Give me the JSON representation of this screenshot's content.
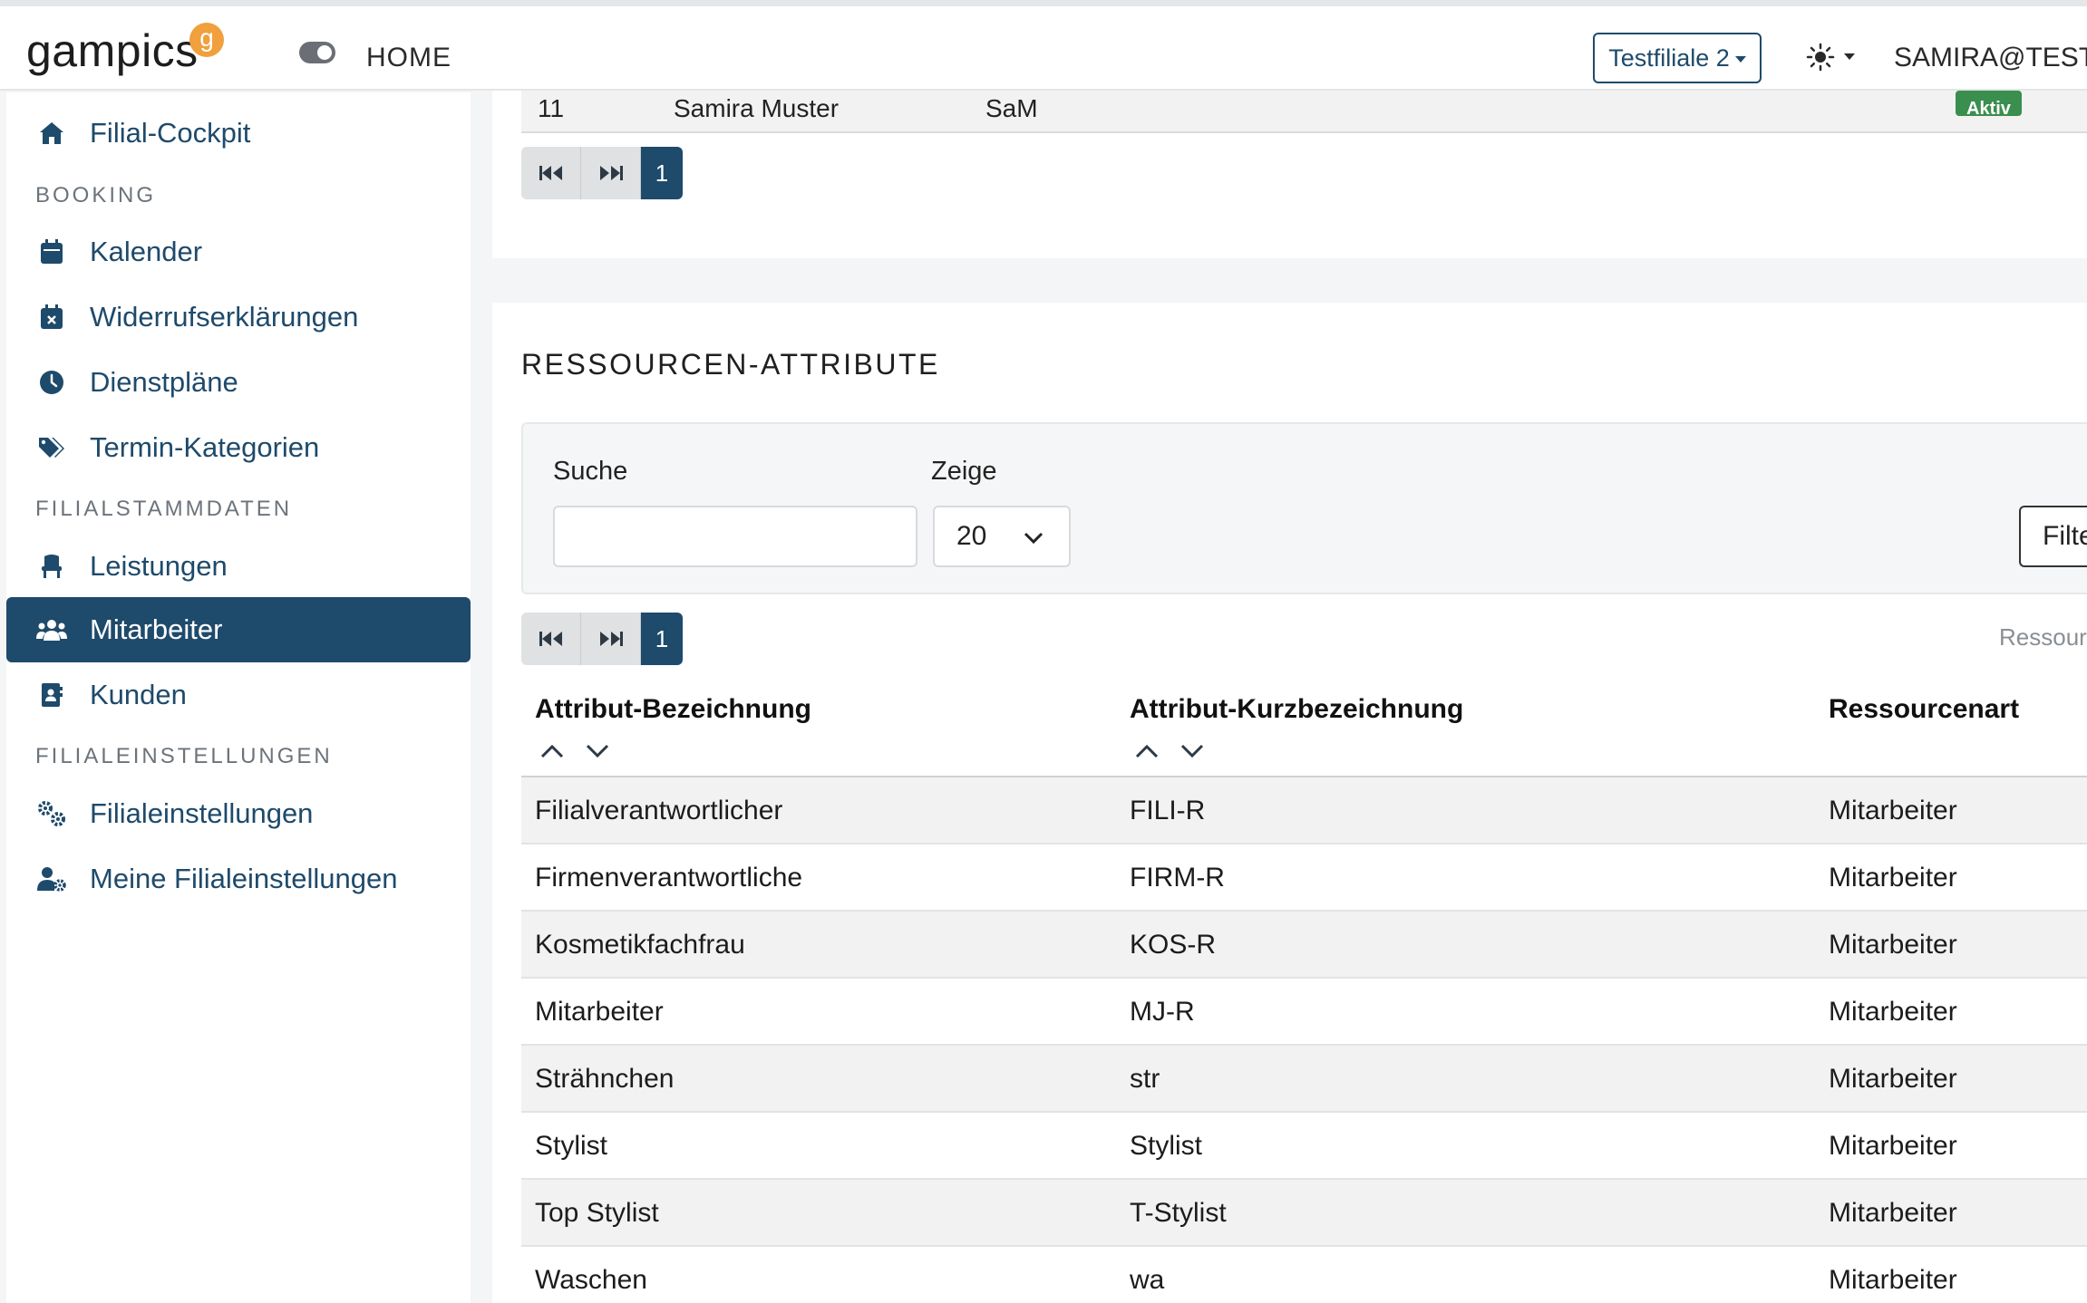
{
  "header": {
    "logo_text": "gampics",
    "logo_badge": "g",
    "home_label": "HOME",
    "branch_label": "Testfiliale 2",
    "user_label": "SAMIRA@TEST.G"
  },
  "sidebar": {
    "items": [
      {
        "label": "Filial-Cockpit",
        "icon": "home-icon"
      },
      {
        "label": "Kalender",
        "icon": "calendar-icon"
      },
      {
        "label": "Widerrufserklärungen",
        "icon": "calendar-x-icon"
      },
      {
        "label": "Dienstpläne",
        "icon": "clock-icon"
      },
      {
        "label": "Termin-Kategorien",
        "icon": "tags-icon"
      },
      {
        "label": "Leistungen",
        "icon": "chair-icon"
      },
      {
        "label": "Mitarbeiter",
        "icon": "users-icon",
        "active": true
      },
      {
        "label": "Kunden",
        "icon": "contact-book-icon"
      },
      {
        "label": "Filialeinstellungen",
        "icon": "gears-icon"
      },
      {
        "label": "Meine Filialeinstellungen",
        "icon": "user-gear-icon"
      }
    ],
    "sections": [
      "BOOKING",
      "FILIALSTAMMDATEN",
      "FILIALEINSTELLUNGEN"
    ]
  },
  "prev_table": {
    "row": {
      "col1": "11",
      "col2": "Samira Muster",
      "col3": "SaM",
      "status": "Aktiv"
    },
    "page": "1"
  },
  "attributes": {
    "title": "RESSOURCEN-ATTRIBUTE",
    "search_label": "Suche",
    "search_value": "",
    "show_label": "Zeige",
    "show_value": "20",
    "filter_label": "Filter",
    "page": "1",
    "resource_label_partial": "Ressour",
    "columns": [
      "Attribut-Bezeichnung",
      "Attribut-Kurzbezeichnung",
      "Ressourcenart"
    ],
    "rows": [
      {
        "name": "Filialverantwortlicher",
        "short": "FILI-R",
        "type": "Mitarbeiter"
      },
      {
        "name": "Firmenverantwortliche",
        "short": "FIRM-R",
        "type": "Mitarbeiter"
      },
      {
        "name": "Kosmetikfachfrau",
        "short": "KOS-R",
        "type": "Mitarbeiter"
      },
      {
        "name": "Mitarbeiter",
        "short": "MJ-R",
        "type": "Mitarbeiter"
      },
      {
        "name": "Strähnchen",
        "short": "str",
        "type": "Mitarbeiter"
      },
      {
        "name": "Stylist",
        "short": "Stylist",
        "type": "Mitarbeiter"
      },
      {
        "name": "Top Stylist",
        "short": "T-Stylist",
        "type": "Mitarbeiter"
      },
      {
        "name": "Waschen",
        "short": "wa",
        "type": "Mitarbeiter"
      }
    ]
  },
  "colors": {
    "primary": "#1e4a6b",
    "success": "#3a8e4e",
    "accent": "#f0a03c"
  }
}
